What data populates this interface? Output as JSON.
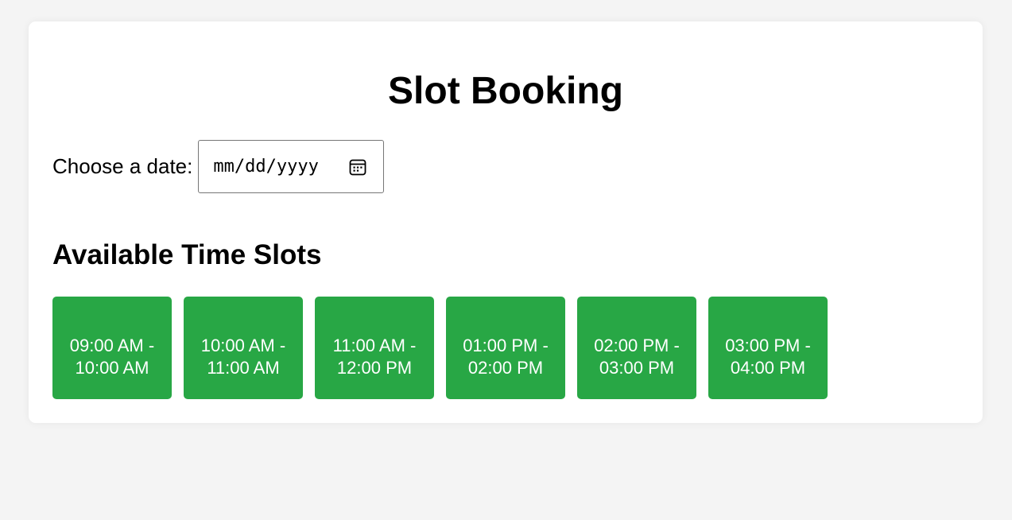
{
  "page": {
    "title": "Slot Booking"
  },
  "date_picker": {
    "label": "Choose a date:",
    "placeholder": "mm/dd/yyyy",
    "icon": "calendar-icon"
  },
  "slots_section": {
    "heading": "Available Time Slots",
    "slots": [
      {
        "label": "09:00 AM - 10:00 AM"
      },
      {
        "label": "10:00 AM - 11:00 AM"
      },
      {
        "label": "11:00 AM - 12:00 PM"
      },
      {
        "label": "01:00 PM - 02:00 PM"
      },
      {
        "label": "02:00 PM - 03:00 PM"
      },
      {
        "label": "03:00 PM - 04:00 PM"
      }
    ]
  },
  "colors": {
    "background": "#f4f4f4",
    "card": "#ffffff",
    "slot_button": "#28a745",
    "slot_text": "#ffffff"
  }
}
